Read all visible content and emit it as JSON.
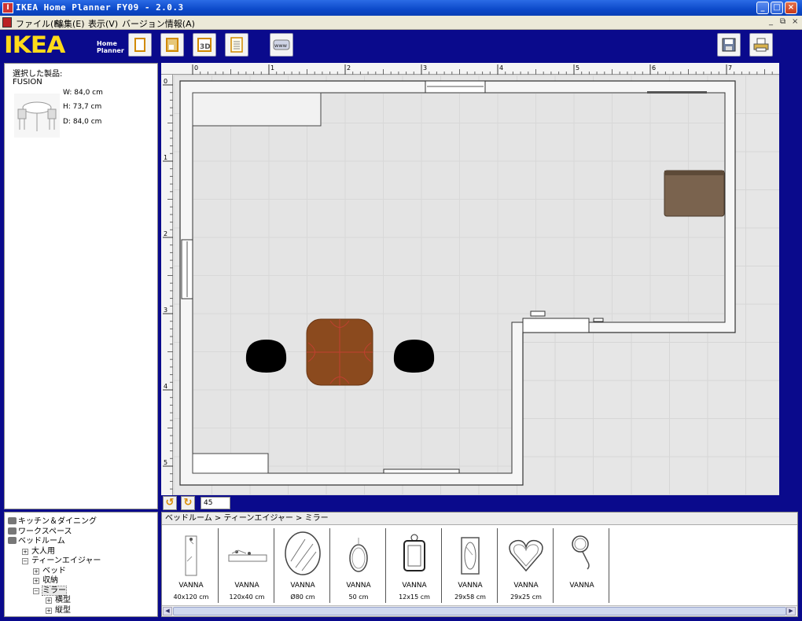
{
  "window": {
    "title": "IKEA Home Planner FY09  - 2.0.3"
  },
  "menu": [
    "ファイル(F)",
    "編集(E)",
    "表示(V)",
    "バージョン情報(A)"
  ],
  "logo": {
    "text": "IKEA",
    "sub_line1": "Home",
    "sub_line2": "Planner"
  },
  "toolbar": {
    "www_label": "www",
    "3d_label": "3D"
  },
  "selected": {
    "label": "選択した製品:",
    "name": "FUSION",
    "width": "W: 84,0 cm",
    "height": "H: 73,7 cm",
    "depth": "D: 84,0 cm"
  },
  "ruler": {
    "top": [
      "0",
      "1",
      "2",
      "3",
      "4",
      "5",
      "6",
      "7"
    ],
    "left": [
      "0",
      "1",
      "2",
      "3",
      "4",
      "5"
    ]
  },
  "angle": "45",
  "tree": [
    {
      "label": "キッチン＆ダイニング",
      "level": 0,
      "box": ""
    },
    {
      "label": "ワークスペース",
      "level": 0,
      "box": ""
    },
    {
      "label": "ベッドルーム",
      "level": 0,
      "box": ""
    },
    {
      "label": "大人用",
      "level": 1,
      "box": "+"
    },
    {
      "label": "ティーンエイジャー",
      "level": 1,
      "box": "−"
    },
    {
      "label": "ベッド",
      "level": 2,
      "box": "+"
    },
    {
      "label": "収納",
      "level": 2,
      "box": "+"
    },
    {
      "label": "ミラー",
      "level": 2,
      "box": "−"
    },
    {
      "label": "横型",
      "level": 3,
      "box": "+"
    },
    {
      "label": "縦型",
      "level": 3,
      "box": "+"
    }
  ],
  "breadcrumb": "ベッドルーム > ティーンエイジャー > ミラー",
  "catalog": [
    {
      "name": "VANNA",
      "size": "40x120 cm",
      "icon": "tall-mirror-icon"
    },
    {
      "name": "VANNA",
      "size": "120x40 cm",
      "icon": "wide-mirror-icon"
    },
    {
      "name": "VANNA",
      "size": "Ø80 cm",
      "icon": "round-mirror-icon"
    },
    {
      "name": "VANNA",
      "size": "50 cm",
      "icon": "oval-mirror-icon"
    },
    {
      "name": "VANNA",
      "size": "12x15 cm",
      "icon": "ornate-mirror-icon"
    },
    {
      "name": "VANNA",
      "size": "29x58 cm",
      "icon": "framed-mirror-icon"
    },
    {
      "name": "VANNA",
      "size": "29x25 cm",
      "icon": "heart-mirror-icon"
    },
    {
      "name": "VANNA",
      "size": "",
      "icon": "hand-mirror-icon"
    }
  ]
}
